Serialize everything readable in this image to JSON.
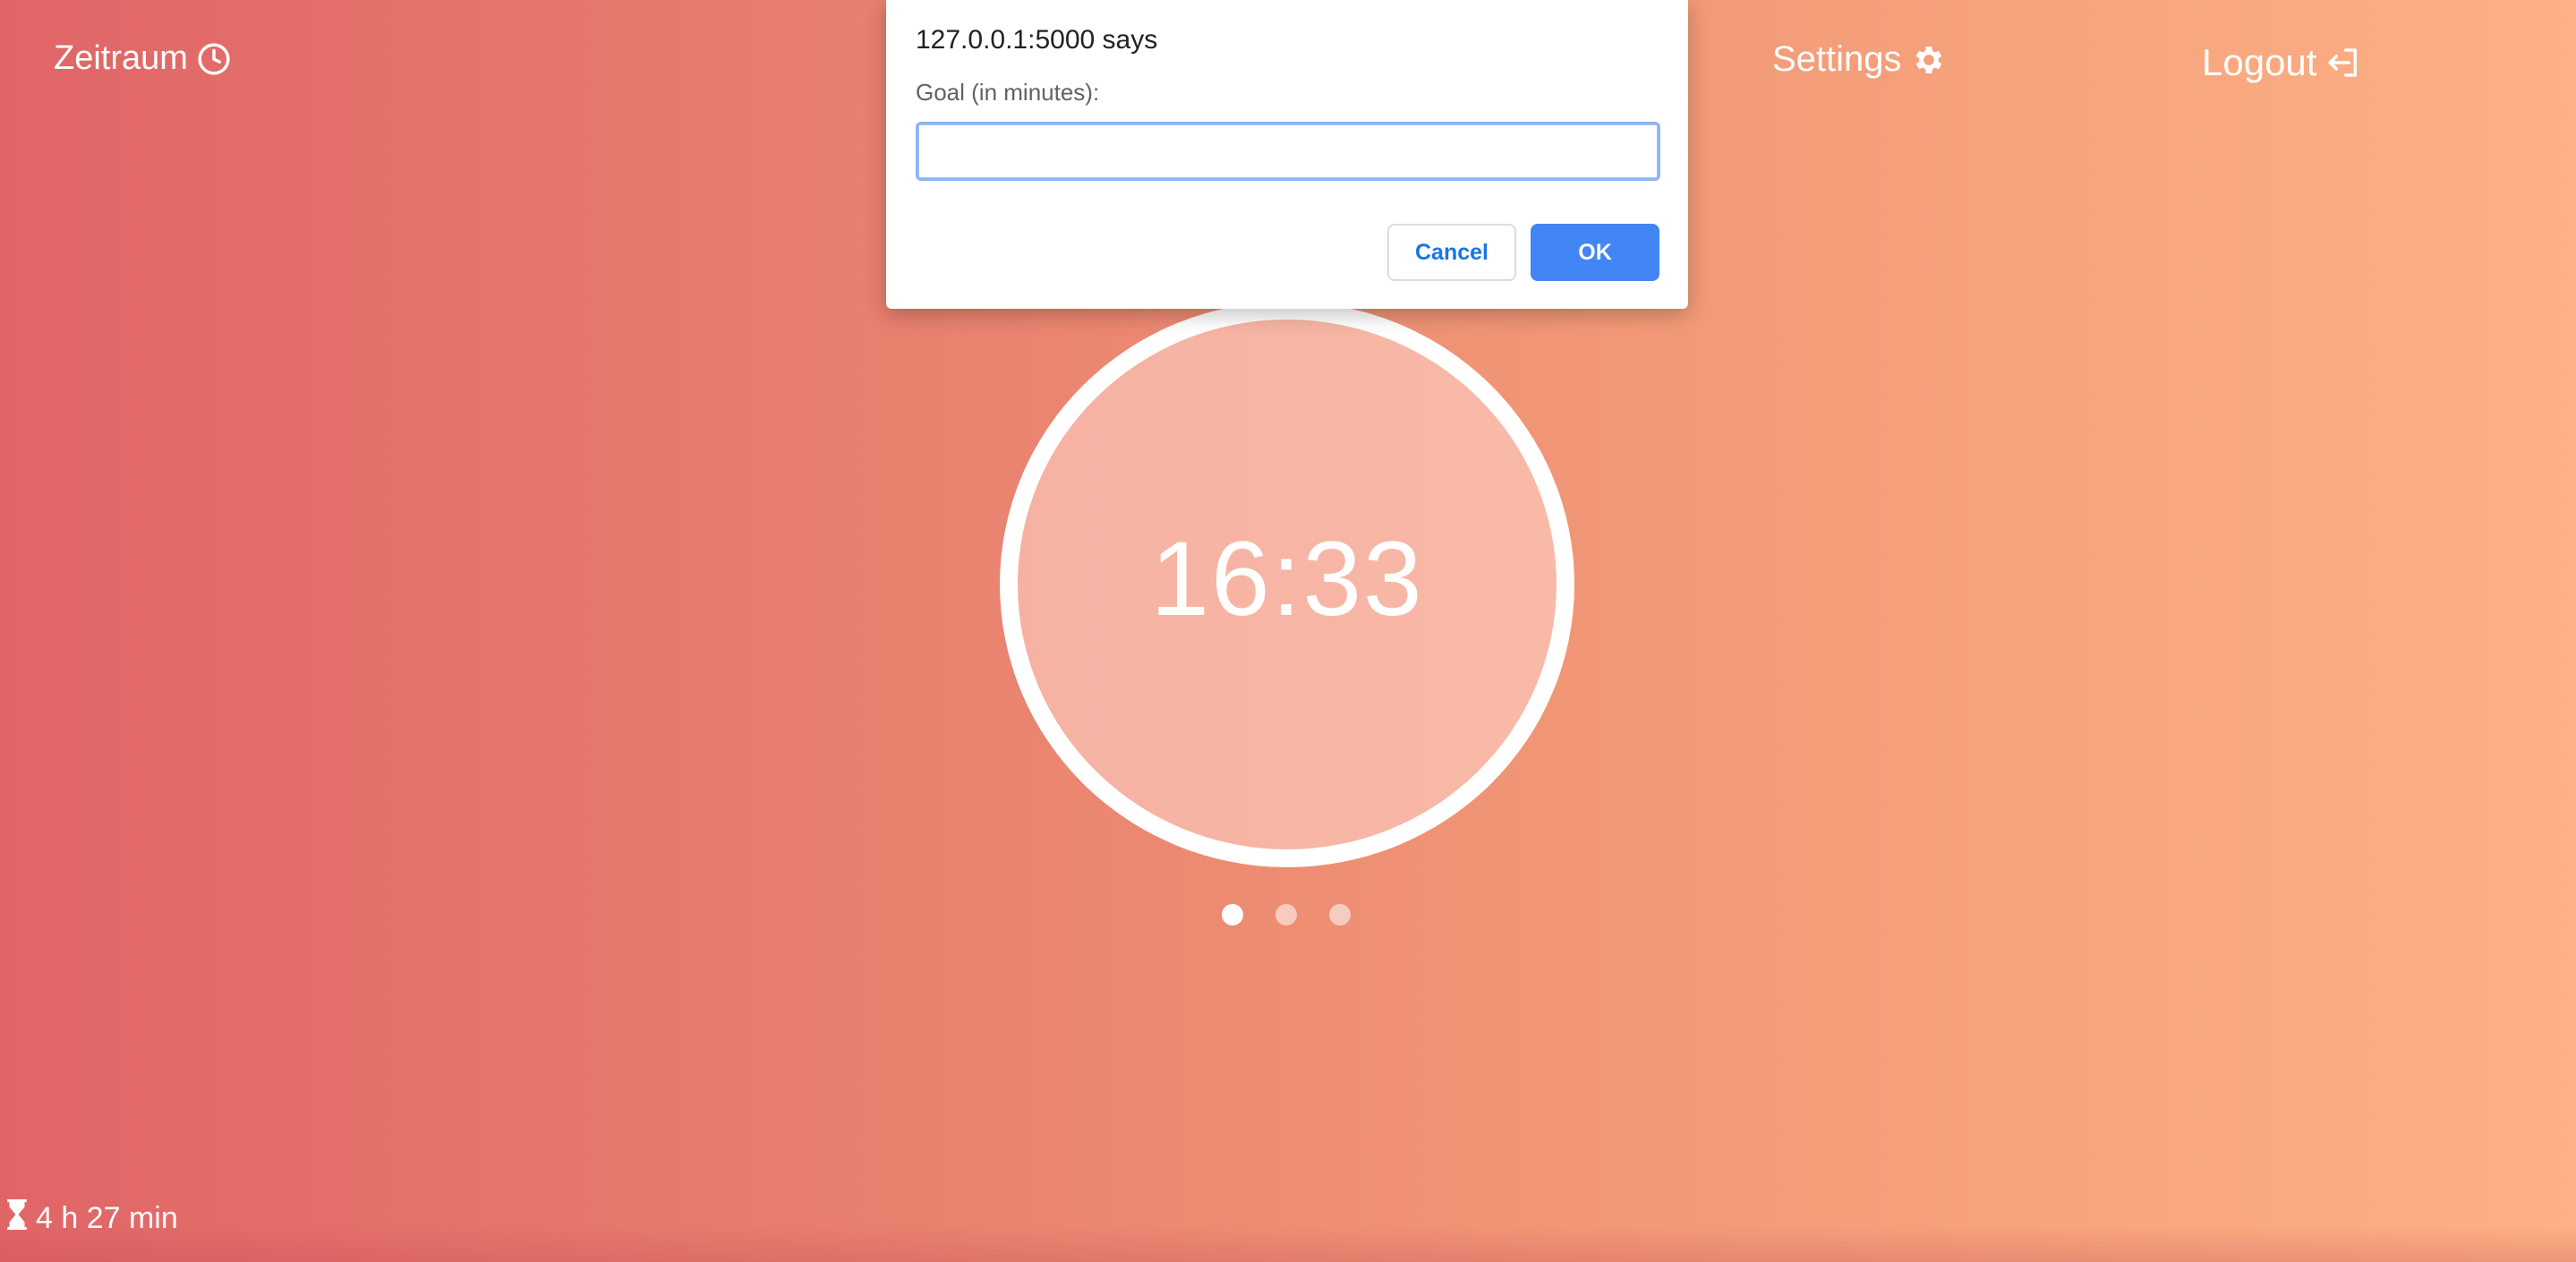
{
  "nav": {
    "brand_label": "Zeitraum",
    "brand_icon": "clock-icon",
    "settings_label": "Settings",
    "settings_icon": "gear-icon",
    "logout_label": "Logout",
    "logout_icon": "sign-out-icon"
  },
  "timer": {
    "display": "16:33"
  },
  "pager": {
    "count": 3,
    "active_index": 0
  },
  "footer": {
    "elapsed_icon": "hourglass-icon",
    "elapsed_text": "4 h 27 min"
  },
  "dialog": {
    "title": "127.0.0.1:5000 says",
    "message": "Goal (in minutes):",
    "input_value": "",
    "cancel_label": "Cancel",
    "ok_label": "OK"
  },
  "colors": {
    "gradient_start": "#e06567",
    "gradient_end": "#fdb184",
    "ok_button": "#4285f4",
    "cancel_text": "#1a73e8"
  }
}
